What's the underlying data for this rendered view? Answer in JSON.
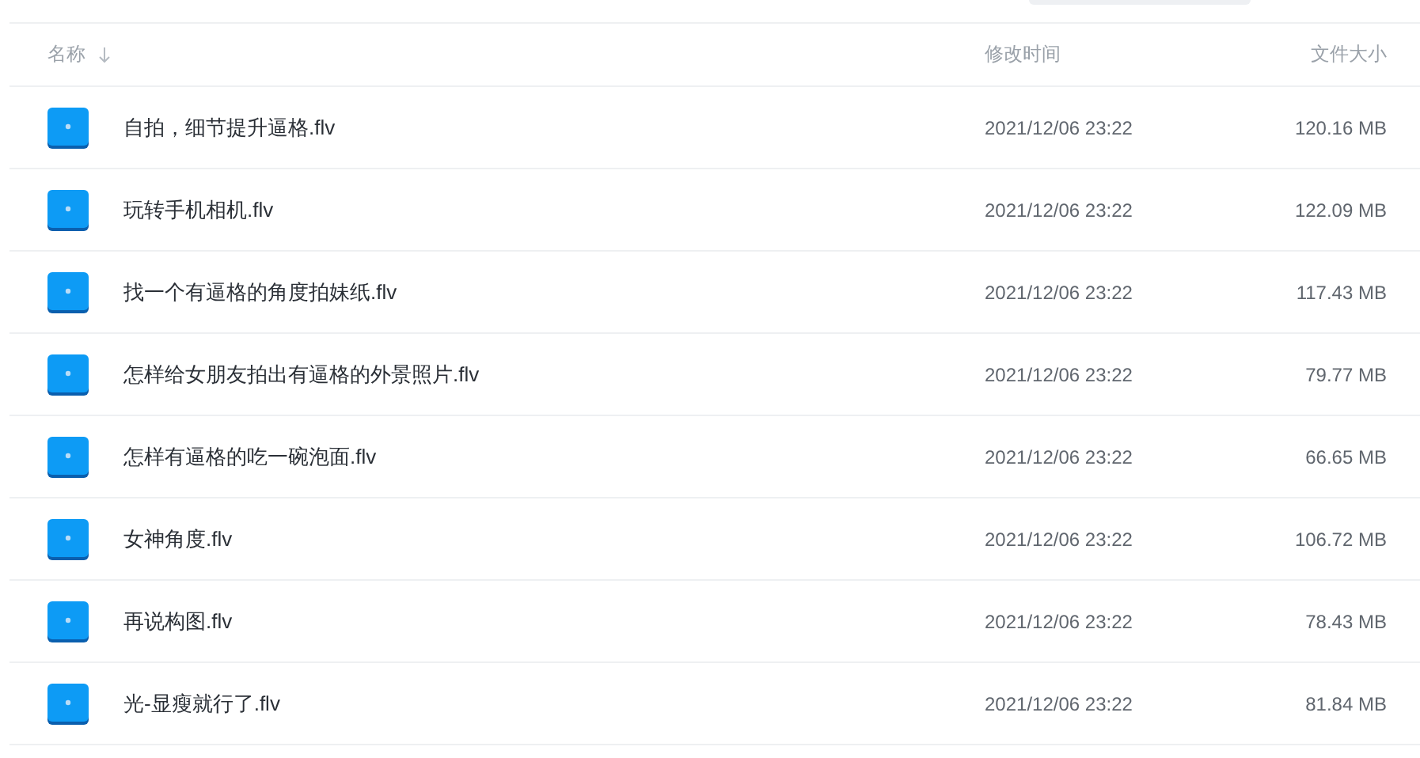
{
  "table": {
    "columns": [
      {
        "label": "名称",
        "sorted": true
      },
      {
        "label": "修改时间",
        "sorted": false
      },
      {
        "label": "文件大小",
        "sorted": false
      }
    ],
    "rows": [
      {
        "name": "自拍，细节提升逼格.flv",
        "modified": "2021/12/06 23:22",
        "size": "120.16 MB"
      },
      {
        "name": "玩转手机相机.flv",
        "modified": "2021/12/06 23:22",
        "size": "122.09 MB"
      },
      {
        "name": "找一个有逼格的角度拍妹纸.flv",
        "modified": "2021/12/06 23:22",
        "size": "117.43 MB"
      },
      {
        "name": "怎样给女朋友拍出有逼格的外景照片.flv",
        "modified": "2021/12/06 23:22",
        "size": "79.77 MB"
      },
      {
        "name": "怎样有逼格的吃一碗泡面.flv",
        "modified": "2021/12/06 23:22",
        "size": "66.65 MB"
      },
      {
        "name": "女神角度.flv",
        "modified": "2021/12/06 23:22",
        "size": "106.72 MB"
      },
      {
        "name": "再说构图.flv",
        "modified": "2021/12/06 23:22",
        "size": "78.43 MB"
      },
      {
        "name": "光-显瘦就行了.flv",
        "modified": "2021/12/06 23:22",
        "size": "81.84 MB"
      }
    ]
  }
}
